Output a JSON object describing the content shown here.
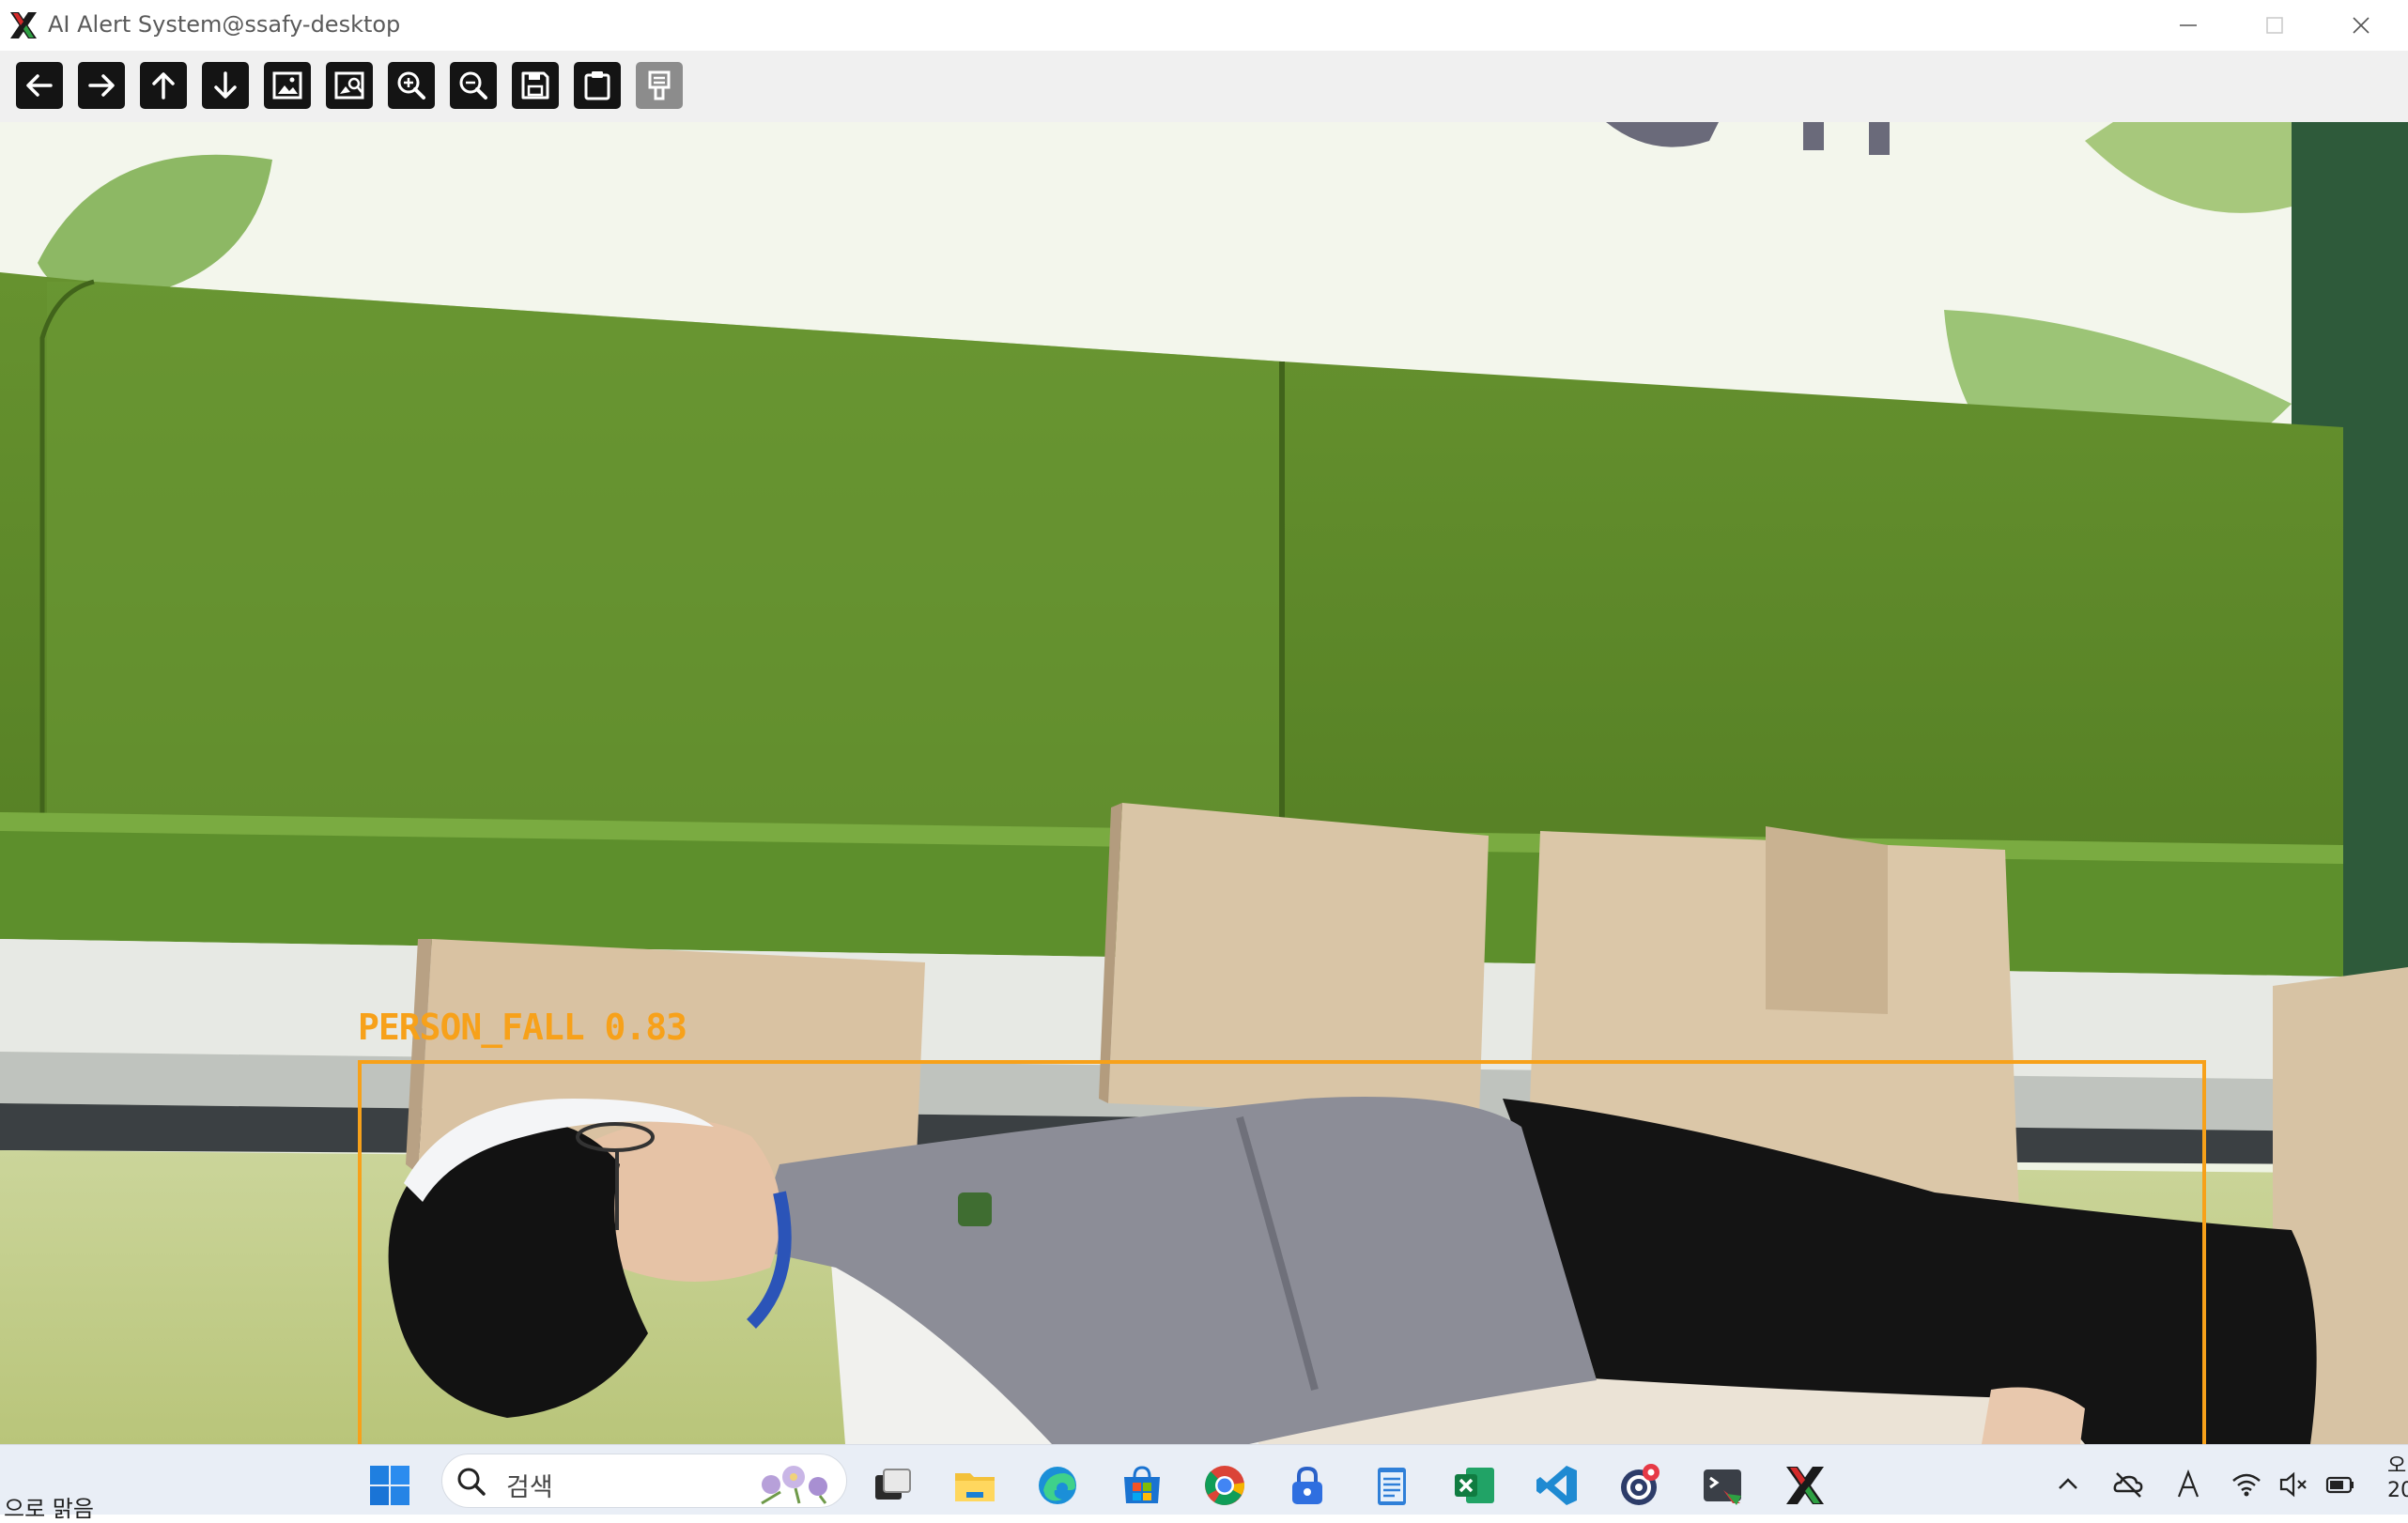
{
  "window": {
    "title": "AI Alert System@ssafy-desktop",
    "controls": [
      "minimize",
      "maximize",
      "close"
    ]
  },
  "toolbar": {
    "buttons": [
      {
        "icon": "arrow-left-icon",
        "enabled": true
      },
      {
        "icon": "arrow-right-icon",
        "enabled": true
      },
      {
        "icon": "arrow-up-icon",
        "enabled": true
      },
      {
        "icon": "arrow-down-icon",
        "enabled": true
      },
      {
        "icon": "image-icon",
        "enabled": true
      },
      {
        "icon": "image-properties-icon",
        "enabled": true
      },
      {
        "icon": "zoom-in-icon",
        "enabled": true
      },
      {
        "icon": "zoom-out-icon",
        "enabled": true
      },
      {
        "icon": "save-icon",
        "enabled": true
      },
      {
        "icon": "copy-to-clipboard-icon",
        "enabled": true
      },
      {
        "icon": "properties-icon",
        "enabled": false
      }
    ]
  },
  "view": {
    "detection": {
      "label": "PERSON_FALL 0.83",
      "box_color": "#f7a11a"
    }
  },
  "taskbar": {
    "weather_text": "으로 맑음",
    "search_placeholder": "검색",
    "apps": [
      "start-icon",
      "search-icon",
      "task-view-icon",
      "file-explorer-icon",
      "edge-icon",
      "microsoft-store-icon",
      "chrome-icon",
      "vpn-lock-icon",
      "notepad-icon",
      "excel-icon",
      "vscode-icon",
      "obs-recorder-icon",
      "terminal-icon",
      "xming-x-icon"
    ],
    "tray": [
      "chevron-up-icon",
      "onedrive-offline-icon",
      "ime-a-icon",
      "wifi-icon",
      "speaker-muted-icon",
      "battery-icon"
    ],
    "clock_partial": "오\n20"
  }
}
